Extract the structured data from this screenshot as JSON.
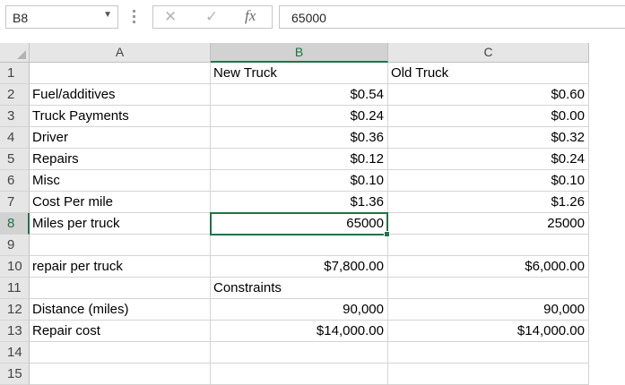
{
  "name_box": {
    "value": "B8"
  },
  "formula_bar": {
    "cancel_glyph": "✕",
    "enter_glyph": "✓",
    "fx_label": "fx",
    "value": "65000"
  },
  "columns": [
    {
      "label": "A",
      "selected": false
    },
    {
      "label": "B",
      "selected": true
    },
    {
      "label": "C",
      "selected": false
    }
  ],
  "rows": [
    {
      "num": "1",
      "a": "",
      "b": "New Truck",
      "c": "Old Truck"
    },
    {
      "num": "2",
      "a": "Fuel/additives",
      "b": "$0.54",
      "c": "$0.60"
    },
    {
      "num": "3",
      "a": "Truck Payments",
      "b": "$0.24",
      "c": "$0.00"
    },
    {
      "num": "4",
      "a": "Driver",
      "b": "$0.36",
      "c": "$0.32"
    },
    {
      "num": "5",
      "a": "Repairs",
      "b": "$0.12",
      "c": "$0.24"
    },
    {
      "num": "6",
      "a": "Misc",
      "b": "$0.10",
      "c": "$0.10"
    },
    {
      "num": "7",
      "a": "Cost Per mile",
      "b": "$1.36",
      "c": "$1.26"
    },
    {
      "num": "8",
      "a": "Miles per truck",
      "b": "65000",
      "c": "25000"
    },
    {
      "num": "9",
      "a": "",
      "b": "",
      "c": ""
    },
    {
      "num": "10",
      "a": "repair per truck",
      "b": "$7,800.00",
      "c": "$6,000.00"
    },
    {
      "num": "11",
      "a": "",
      "b": "Constraints",
      "c": ""
    },
    {
      "num": "12",
      "a": "Distance (miles)",
      "b": "90,000",
      "c": "90,000"
    },
    {
      "num": "13",
      "a": "Repair cost",
      "b": "$14,000.00",
      "c": "$14,000.00"
    },
    {
      "num": "14",
      "a": "",
      "b": "",
      "c": ""
    },
    {
      "num": "15",
      "a": "",
      "b": "",
      "c": ""
    }
  ],
  "selected_cell": "B8",
  "colors": {
    "accent": "#217346",
    "header_bg": "#e6e6e6",
    "gridline": "#d4d4d4"
  }
}
